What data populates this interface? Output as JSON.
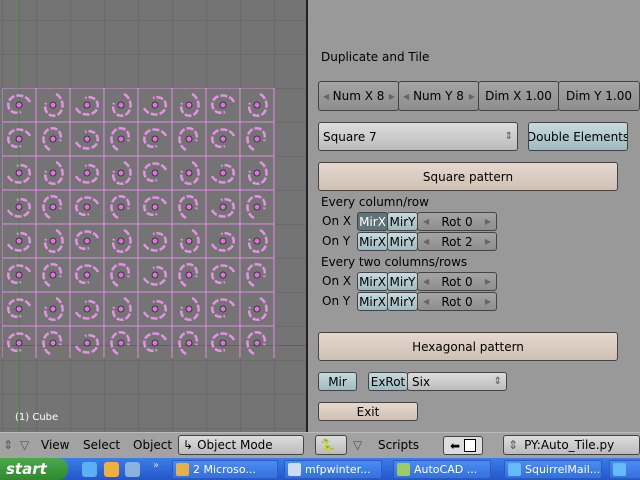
{
  "viewport": {
    "object_label": "(1) Cube",
    "grid": {
      "cols": 8,
      "rows": 8
    },
    "wire_color": "#e890e8"
  },
  "panel": {
    "title": "Duplicate and Tile",
    "num_x": "Num X 8",
    "num_y": "Num Y 8",
    "dim_x": "Dim X 1.00",
    "dim_y": "Dim Y 1.00",
    "shape_menu": "Square 7",
    "double_elements": "Double Elements",
    "square_pattern": "Square pattern",
    "every_col_row": "Every column/row",
    "every_two": "Every two columns/rows",
    "rows": [
      {
        "label": "On X",
        "mirx": "MirX",
        "miry": "MirY",
        "rot": "Rot 0",
        "mirx_on": true
      },
      {
        "label": "On Y",
        "mirx": "MirX",
        "miry": "MirY",
        "rot": "Rot 2",
        "mirx_on": false
      },
      {
        "label": "On X",
        "mirx": "MirX",
        "miry": "MirY",
        "rot": "Rot 0",
        "mirx_on": false
      },
      {
        "label": "On Y",
        "mirx": "MirX",
        "miry": "MirY",
        "rot": "Rot 0",
        "mirx_on": false
      }
    ],
    "hex_pattern": "Hexagonal pattern",
    "mir": "Mir",
    "exrot": "ExRot",
    "six_menu": "Six",
    "exit": "Exit"
  },
  "header": {
    "view": "View",
    "select": "Select",
    "object": "Object",
    "mode": "Object Mode",
    "scripts": "Scripts",
    "script_name": "PY:Auto_Tile.py"
  },
  "taskbar": {
    "start": "start",
    "items": [
      "2 Microso...",
      "mfpwinter...",
      "AutoCAD ...",
      "SquirrelMail..."
    ]
  }
}
